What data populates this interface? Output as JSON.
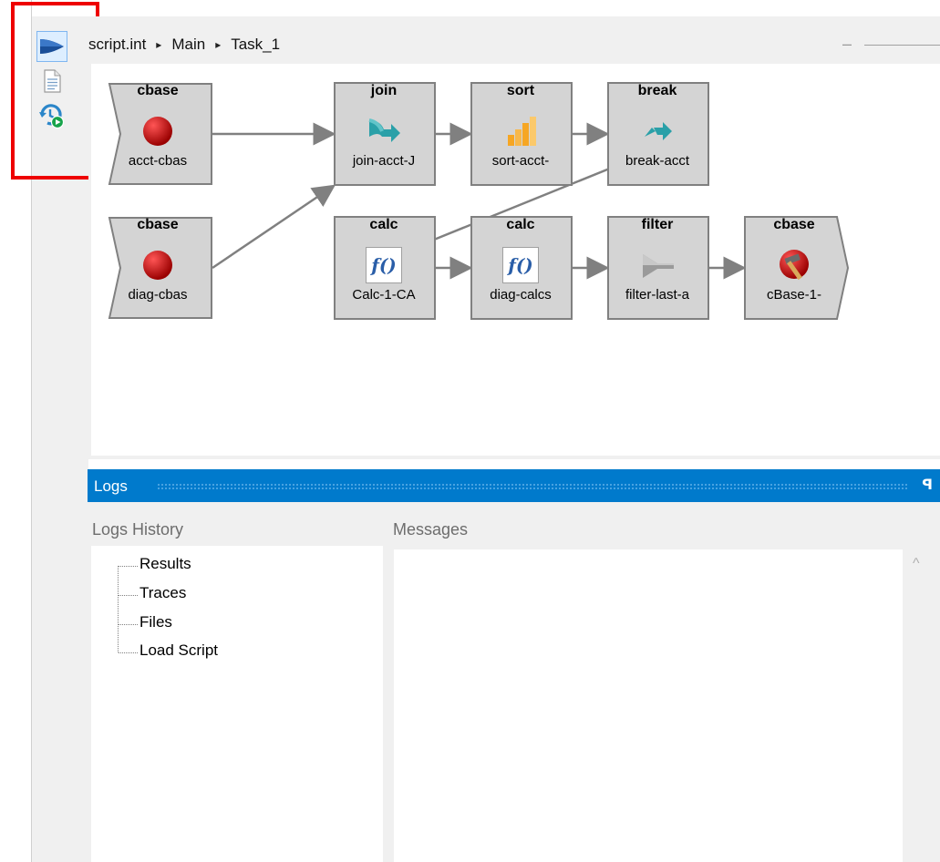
{
  "breadcrumb": {
    "items": [
      "script.int",
      "Main",
      "Task_1"
    ],
    "separator": "▸"
  },
  "toolbar": {
    "buttons": [
      {
        "icon": "run-flow-icon",
        "active": true
      },
      {
        "icon": "document-icon",
        "active": false
      },
      {
        "icon": "refresh-history-icon",
        "active": false
      }
    ],
    "highlight_color": "#ee0000"
  },
  "diagram": {
    "nodes": [
      {
        "id": "n1",
        "type": "cbase",
        "title": "cbase",
        "label": "acct-cbas",
        "icon": "red-ball-icon",
        "shape": "source"
      },
      {
        "id": "n2",
        "type": "cbase",
        "title": "cbase",
        "label": "diag-cbas",
        "icon": "red-ball-icon",
        "shape": "source"
      },
      {
        "id": "n3",
        "type": "join",
        "title": "join",
        "label": "join-acct-J",
        "icon": "join-arrow-icon",
        "shape": "box"
      },
      {
        "id": "n4",
        "type": "sort",
        "title": "sort",
        "label": "sort-acct-",
        "icon": "sort-bars-icon",
        "shape": "box"
      },
      {
        "id": "n5",
        "type": "break",
        "title": "break",
        "label": "break-acct",
        "icon": "break-arrow-icon",
        "shape": "box"
      },
      {
        "id": "n6",
        "type": "calc",
        "title": "calc",
        "label": "Calc-1-CA",
        "icon": "function-icon",
        "shape": "box"
      },
      {
        "id": "n7",
        "type": "calc",
        "title": "calc",
        "label": "diag-calcs",
        "icon": "function-icon",
        "shape": "box"
      },
      {
        "id": "n8",
        "type": "filter",
        "title": "filter",
        "label": "filter-last-a",
        "icon": "funnel-icon",
        "shape": "box"
      },
      {
        "id": "n9",
        "type": "cbase",
        "title": "cbase",
        "label": "cBase-1-",
        "icon": "red-ball-hammer-icon",
        "shape": "sink"
      }
    ],
    "edges": [
      [
        "n1",
        "n3"
      ],
      [
        "n2",
        "n3"
      ],
      [
        "n3",
        "n4"
      ],
      [
        "n4",
        "n5"
      ],
      [
        "n5",
        "n6"
      ],
      [
        "n6",
        "n7"
      ],
      [
        "n7",
        "n8"
      ],
      [
        "n8",
        "n9"
      ]
    ],
    "function_glyph": "f()"
  },
  "logs": {
    "panel_title": "Logs",
    "pin_glyph": "ꟼ",
    "history_label": "Logs History",
    "messages_label": "Messages",
    "history_items": [
      "Results",
      "Traces",
      "Files",
      "Load Script"
    ]
  },
  "colors": {
    "accent": "#007acc",
    "node_fill": "#d4d4d4",
    "node_border": "#808080",
    "edge": "#808080"
  }
}
